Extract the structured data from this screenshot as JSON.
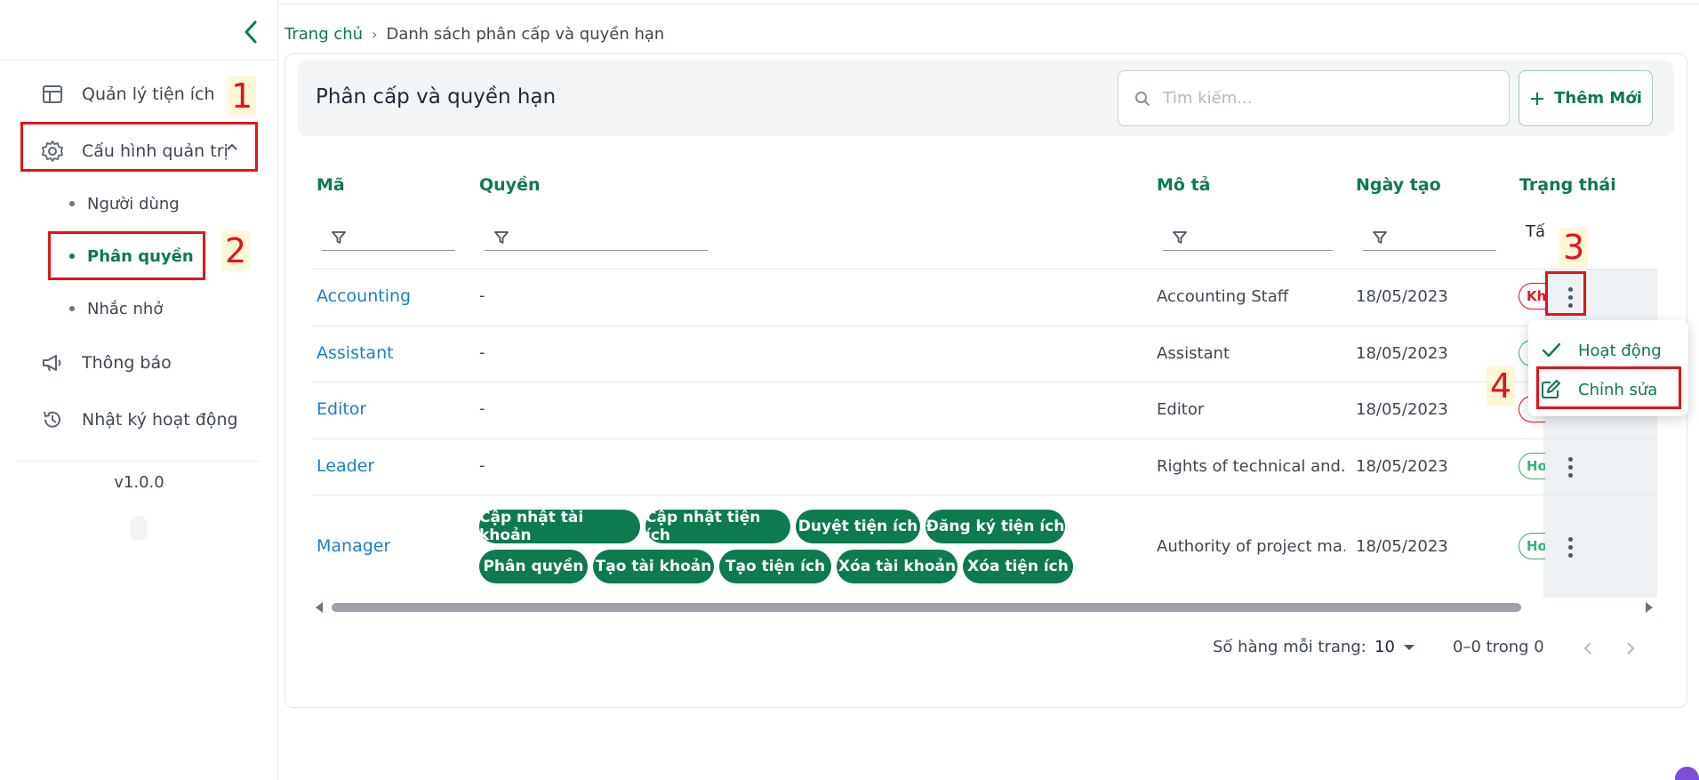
{
  "sidebar": {
    "items": [
      {
        "label": "Quản lý tiện ích"
      },
      {
        "label": "Cấu hình quản trị"
      },
      {
        "label": "Thông báo"
      },
      {
        "label": "Nhật ký hoạt động"
      }
    ],
    "sub_items": [
      {
        "label": "Người dùng",
        "active": false
      },
      {
        "label": "Phân quyền",
        "active": true
      },
      {
        "label": "Nhắc nhở",
        "active": false
      }
    ],
    "version": "v1.0.0"
  },
  "annotations": [
    "1",
    "2",
    "3",
    "4"
  ],
  "breadcrumb": {
    "home": "Trang chủ",
    "separator": "›",
    "current": "Danh sách phân cấp và quyền hạn"
  },
  "header": {
    "title": "Phân cấp và quyền hạn",
    "search_placeholder": "Tìm kiếm...",
    "add_label": "Thêm Mới"
  },
  "table": {
    "columns": [
      "Mã",
      "Quyền",
      "Mô tả",
      "Ngày tạo",
      "Trạng thái"
    ],
    "status_filter_text": "Tấ",
    "rows": [
      {
        "code": "Accounting",
        "rights": "-",
        "description": "Accounting Staff",
        "date": "18/05/2023",
        "status": "Kh",
        "status_type": "inactive"
      },
      {
        "code": "Assistant",
        "rights": "-",
        "description": "Assistant",
        "date": "18/05/2023",
        "status": "",
        "status_type": "active"
      },
      {
        "code": "Editor",
        "rights": "-",
        "description": "Editor",
        "date": "18/05/2023",
        "status": "",
        "status_type": "inactive"
      },
      {
        "code": "Leader",
        "rights": "-",
        "description": "Rights of technical and...",
        "date": "18/05/2023",
        "status": "Ho",
        "status_type": "active"
      },
      {
        "code": "Manager",
        "rights": "",
        "description": "Authority of project ma...",
        "date": "18/05/2023",
        "status": "Ho",
        "status_type": "active"
      }
    ],
    "manager_chips": [
      "Cập nhật tài khoản",
      "Cập nhật tiện ích",
      "Duyệt tiện ích",
      "Đăng ký tiện ích",
      "Phân quyền",
      "Tạo tài khoản",
      "Tạo tiện ích",
      "Xóa tài khoản",
      "Xóa tiện ích"
    ]
  },
  "pagination": {
    "rows_label": "Số hàng mỗi trang:",
    "rows_value": "10",
    "range": "0–0 trong 0"
  },
  "menu": {
    "items": [
      {
        "label": "Hoạt động",
        "icon": "check-icon"
      },
      {
        "label": "Chỉnh sửa",
        "icon": "edit-icon"
      }
    ]
  },
  "colors": {
    "primary": "#0d7a4f",
    "link": "#1a7fc9",
    "annotation": "#e3141a"
  }
}
